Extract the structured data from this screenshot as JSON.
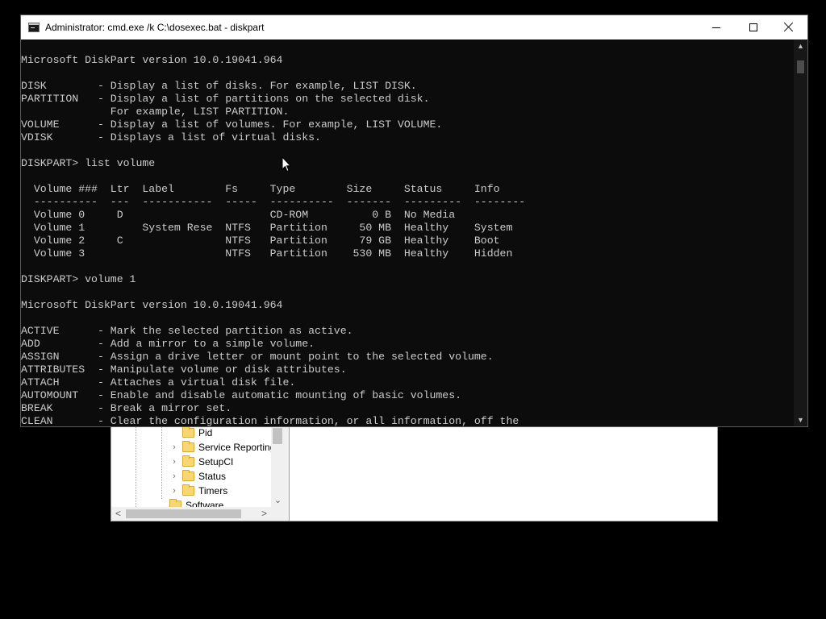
{
  "regedit": {
    "tree_items": [
      {
        "label": "Pid",
        "expandable": false
      },
      {
        "label": "Service Reporting",
        "expandable": true
      },
      {
        "label": "SetupCI",
        "expandable": true
      },
      {
        "label": "Status",
        "expandable": true
      },
      {
        "label": "Timers",
        "expandable": true
      },
      {
        "label": "Software",
        "expandable": false
      }
    ],
    "scroll_left_glyph": "<",
    "scroll_right_glyph": ">",
    "scroll_down_glyph": "⌄",
    "expand_glyph": "›"
  },
  "console": {
    "title": "Administrator: cmd.exe /k C:\\dosexec.bat - diskpart",
    "icon": "cmd-icon",
    "lines": [
      "Microsoft DiskPart version 10.0.19041.964",
      "",
      "DISK        - Display a list of disks. For example, LIST DISK.",
      "PARTITION   - Display a list of partitions on the selected disk.",
      "              For example, LIST PARTITION.",
      "VOLUME      - Display a list of volumes. For example, LIST VOLUME.",
      "VDISK       - Displays a list of virtual disks.",
      "",
      "DISKPART> list volume",
      "",
      "  Volume ###  Ltr  Label        Fs     Type        Size     Status     Info",
      "  ----------  ---  -----------  -----  ----------  -------  ---------  --------",
      "  Volume 0     D                       CD-ROM          0 B  No Media",
      "  Volume 1         System Rese  NTFS   Partition     50 MB  Healthy    System",
      "  Volume 2     C                NTFS   Partition     79 GB  Healthy    Boot",
      "  Volume 3                      NTFS   Partition    530 MB  Healthy    Hidden",
      "",
      "DISKPART> volume 1",
      "",
      "Microsoft DiskPart version 10.0.19041.964",
      "",
      "ACTIVE      - Mark the selected partition as active.",
      "ADD         - Add a mirror to a simple volume.",
      "ASSIGN      - Assign a drive letter or mount point to the selected volume.",
      "ATTRIBUTES  - Manipulate volume or disk attributes.",
      "ATTACH      - Attaches a virtual disk file.",
      "AUTOMOUNT   - Enable and disable automatic mounting of basic volumes.",
      "BREAK       - Break a mirror set.",
      "CLEAN       - Clear the configuration information, or all information, off the"
    ],
    "scroll_up_glyph": "▲",
    "scroll_down_glyph": "▼"
  },
  "colors": {
    "console_bg": "#0c0c0c",
    "console_text": "#cccccc",
    "desktop": "#000000"
  }
}
